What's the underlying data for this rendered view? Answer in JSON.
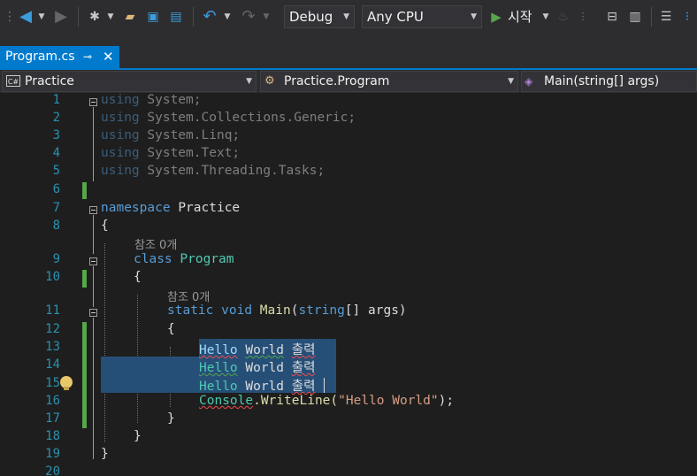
{
  "toolbar": {
    "config": "Debug",
    "platform": "Any CPU",
    "run_label": "시작"
  },
  "tab": {
    "title": "Program.cs",
    "pin": "⊸",
    "close": "✕"
  },
  "nav": {
    "project": "Practice",
    "type": "Practice.Program",
    "member": "Main(string[] args)"
  },
  "editor": {
    "line_numbers": [
      "1",
      "2",
      "3",
      "4",
      "5",
      "6",
      "7",
      "8",
      "9",
      "10",
      "11",
      "12",
      "13",
      "14",
      "15",
      "16",
      "17",
      "18",
      "19",
      "20"
    ],
    "lens_class": "참조 0개",
    "lens_method": "참조 0개",
    "using_kw": "using",
    "using_ns": [
      "System;",
      "System.Collections.Generic;",
      "System.Linq;",
      "System.Text;",
      "System.Threading.Tasks;"
    ],
    "namespace_kw": "namespace",
    "namespace_name": "Practice",
    "class_kw": "class",
    "class_name": "Program",
    "static_kw": "static",
    "void_kw": "void",
    "main_name": "Main",
    "string_kw": "string",
    "params": "[] args)",
    "hello": "Hello",
    "world": "World",
    "chulryeok": "출력",
    "console": "Console",
    "writeline": ".WriteLine(",
    "hello_str": "\"Hello World\"",
    "end_call": ");",
    "open_brace": "{",
    "close_brace": "}"
  }
}
